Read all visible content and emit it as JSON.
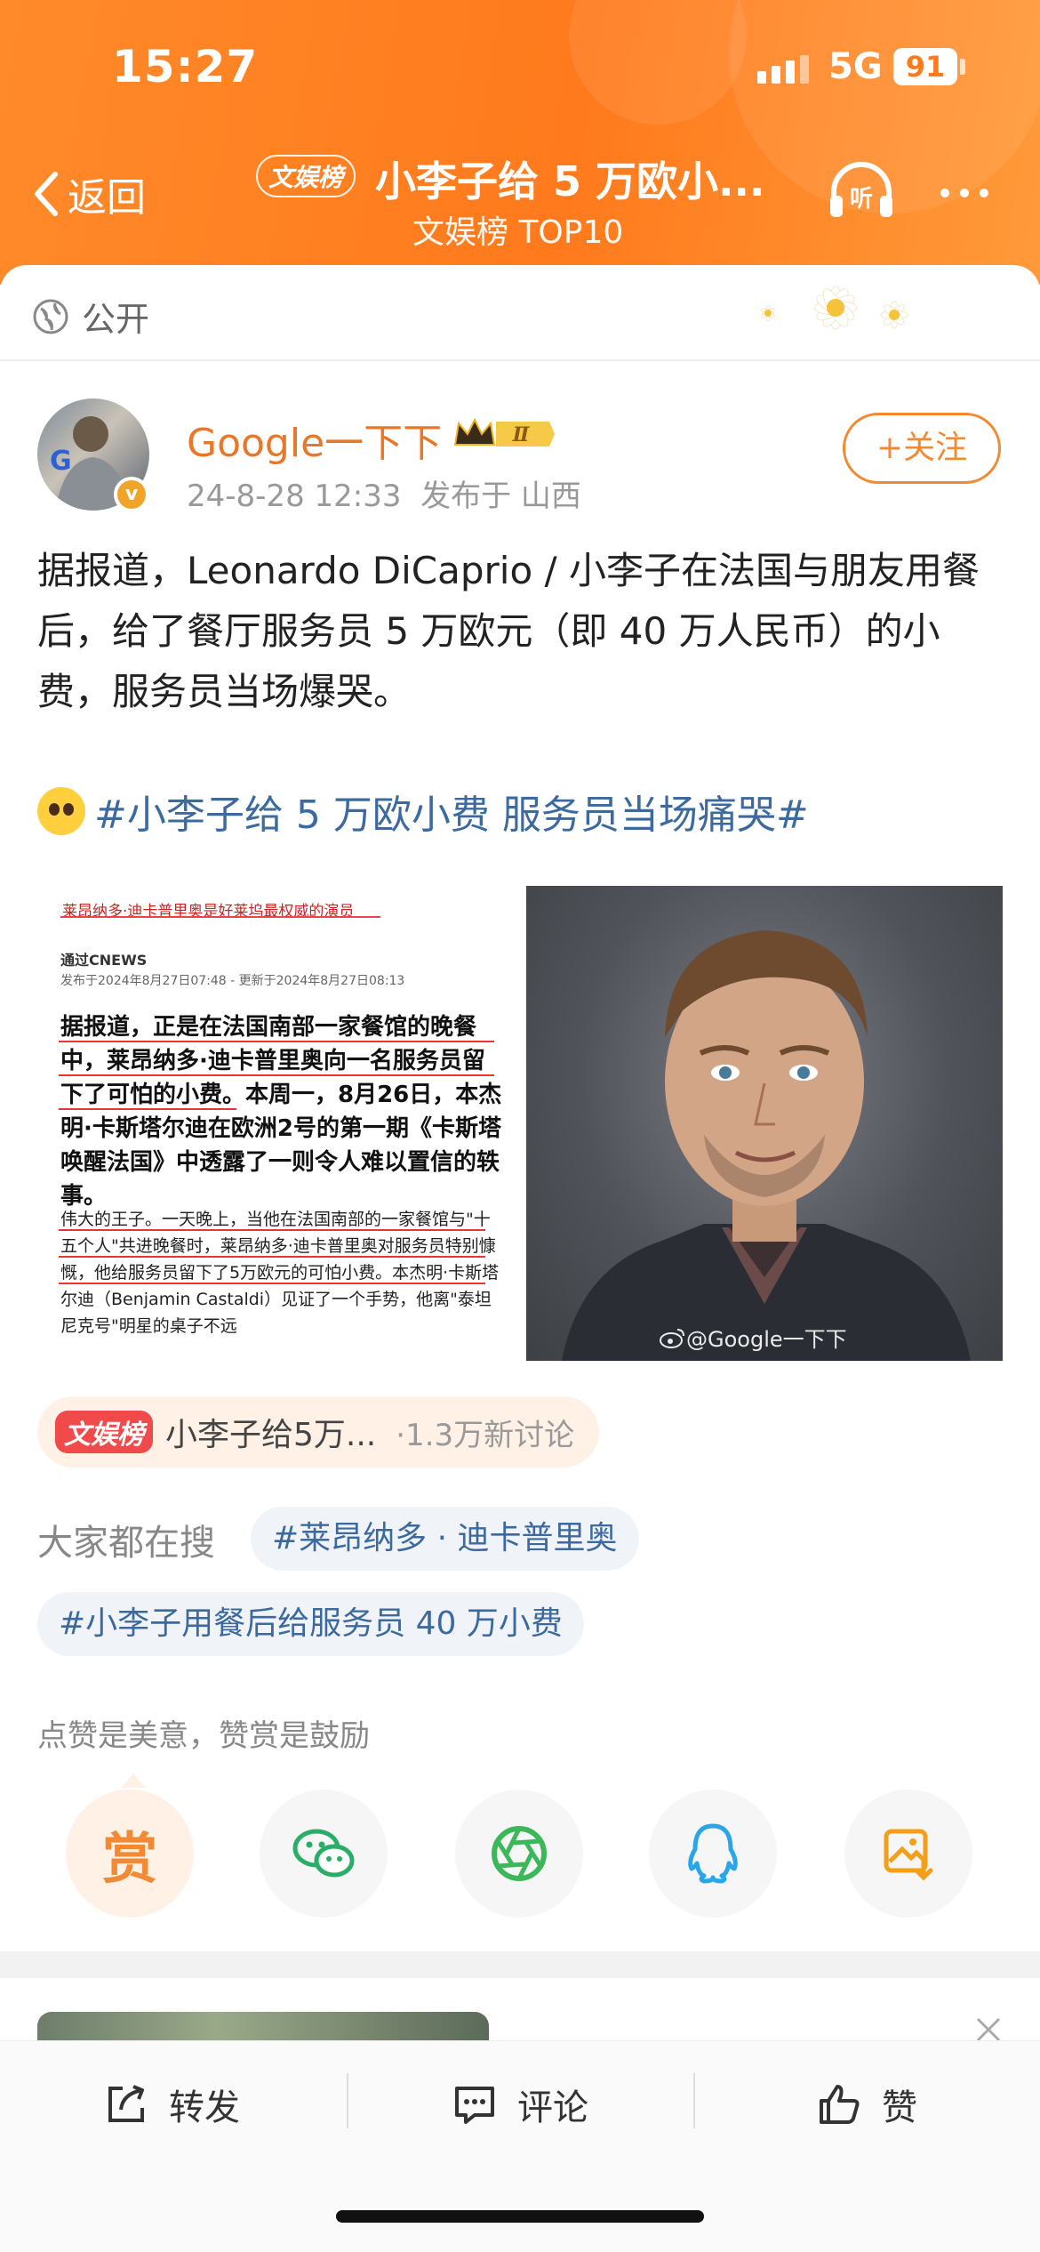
{
  "status_bar": {
    "time": "15:27",
    "network": "5G",
    "battery": "91"
  },
  "nav": {
    "back_label": "返回",
    "tag": "文娱榜",
    "title": "小李子给 5 万欧小...",
    "subtitle": "文娱榜 TOP10",
    "listen_icon": "headphones-icon",
    "more_icon": "more-icon"
  },
  "visibility": {
    "label": "公开",
    "icon": "globe-icon"
  },
  "post": {
    "username": "Google一下下",
    "level_badge": "Ⅱ",
    "verified": "v",
    "timestamp": "24-8-28 12:33",
    "location": "发布于 山西",
    "follow_label": "+关注",
    "text": "据报道，Leonardo DiCaprio / 小李子在法国与朋友用餐后，给了餐厅服务员 5 万欧元（即 40 万人民币）的小费，服务员当场爆哭。",
    "hashtag": "#小李子给 5 万欧小费 服务员当场痛哭#",
    "image_news": {
      "header": "莱昂纳多·迪卡普里奥是好莱坞最权威的演员",
      "source": "通过CNEWS",
      "date": "发布于2024年8月27日07:48 - 更新于2024年8月27日08:13",
      "para1": "据报道，正是在法国南部一家餐馆的晚餐中，莱昂纳多·迪卡普里奥向一名服务员留下了可怕的小费。本周一，8月26日，本杰明·卡斯塔尔迪在欧洲2号的第一期《卡斯塔唤醒法国》中透露了一则令人难以置信的轶事。",
      "para2": "伟大的王子。一天晚上，当他在法国南部的一家餐馆与\"十五个人\"共进晚餐时，莱昂纳多·迪卡普里奥对服务员特别慷慨，他给服务员留下了5万欧元的可怕小费。本杰明·卡斯塔尔迪（Benjamin Castaldi）见证了一个手势，他离\"泰坦尼克号\"明星的桌子不远"
    },
    "image_portrait": {
      "watermark": "@Google一下下"
    }
  },
  "topic": {
    "tag": "文娱榜",
    "text": "小李子给5万...",
    "count": "·1.3万新讨论"
  },
  "searches": {
    "label": "大家都在搜",
    "chips": [
      "#莱昂纳多 · 迪卡普里奥",
      "#小李子用餐后给服务员 40 万小费"
    ]
  },
  "reward": {
    "note": "点赞是美意，赞赏是鼓励",
    "reward_label": "赏",
    "share_targets": [
      "wechat-icon",
      "moments-icon",
      "qq-icon",
      "save-image-icon"
    ]
  },
  "bottom_bar": {
    "repost": "转发",
    "comment": "评论",
    "like": "赞"
  },
  "colors": {
    "brand_orange": "#ff7a1c",
    "link_blue": "#3c6a9e",
    "username_orange": "#e8772a"
  }
}
